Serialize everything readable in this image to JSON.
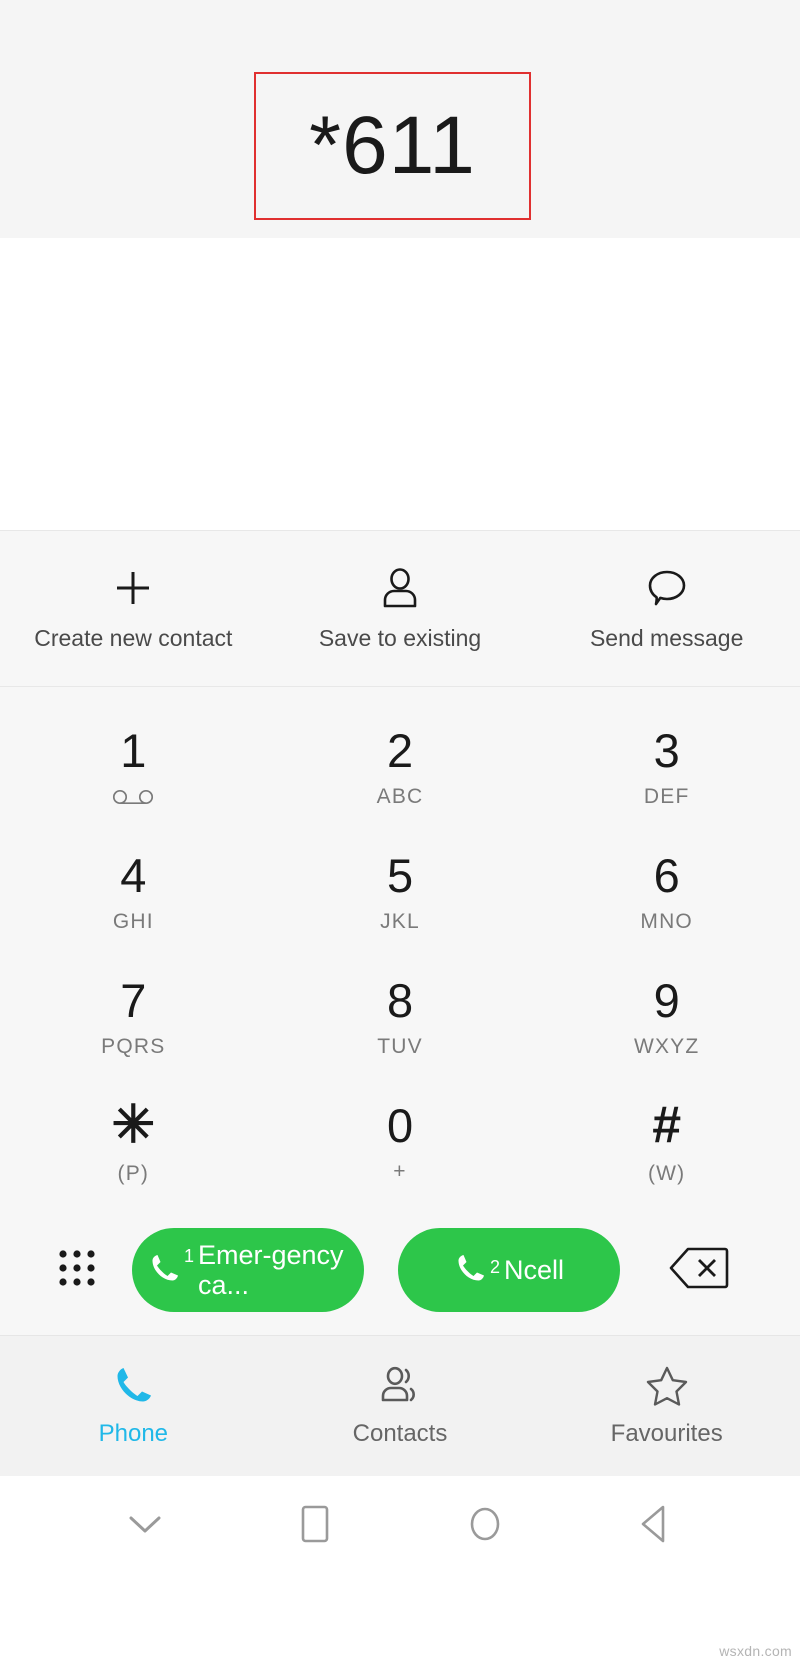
{
  "dialer": {
    "entered_number": "*611",
    "highlight_color": "#e03030"
  },
  "actions": [
    {
      "label": "Create new contact",
      "icon": "plus-icon"
    },
    {
      "label": "Save to existing",
      "icon": "person-icon"
    },
    {
      "label": "Send message",
      "icon": "speech-bubble-icon"
    }
  ],
  "keypad": {
    "rows": [
      [
        {
          "digit": "1",
          "sub": "",
          "sub_icon": "voicemail-icon"
        },
        {
          "digit": "2",
          "sub": "ABC",
          "sub_icon": ""
        },
        {
          "digit": "3",
          "sub": "DEF",
          "sub_icon": ""
        }
      ],
      [
        {
          "digit": "4",
          "sub": "GHI",
          "sub_icon": ""
        },
        {
          "digit": "5",
          "sub": "JKL",
          "sub_icon": ""
        },
        {
          "digit": "6",
          "sub": "MNO",
          "sub_icon": ""
        }
      ],
      [
        {
          "digit": "7",
          "sub": "PQRS",
          "sub_icon": ""
        },
        {
          "digit": "8",
          "sub": "TUV",
          "sub_icon": ""
        },
        {
          "digit": "9",
          "sub": "WXYZ",
          "sub_icon": ""
        }
      ],
      [
        {
          "digit": "✳",
          "sub": "(P)",
          "sub_icon": ""
        },
        {
          "digit": "0",
          "sub": "+",
          "sub_icon": ""
        },
        {
          "digit": "#",
          "sub": "(W)",
          "sub_icon": ""
        }
      ]
    ]
  },
  "call_row": {
    "grid_toggle_icon": "keypad-dots-icon",
    "backspace_icon": "backspace-icon",
    "buttons": [
      {
        "sim": "1",
        "label": "Emer-gency ca...",
        "color": "#2dc64a"
      },
      {
        "sim": "2",
        "label": "Ncell",
        "color": "#2dc64a"
      }
    ]
  },
  "tabs": [
    {
      "label": "Phone",
      "icon": "phone-icon",
      "active": true
    },
    {
      "label": "Contacts",
      "icon": "contacts-icon",
      "active": false
    },
    {
      "label": "Favourites",
      "icon": "star-icon",
      "active": false
    }
  ],
  "system_nav": [
    {
      "icon": "chevron-down-icon"
    },
    {
      "icon": "square-icon"
    },
    {
      "icon": "circle-icon"
    },
    {
      "icon": "back-triangle-icon"
    }
  ],
  "watermark": "wsxdn.com",
  "colors": {
    "accent_active": "#20b8e8",
    "call_green": "#2dc64a",
    "highlight_red": "#e03030"
  }
}
